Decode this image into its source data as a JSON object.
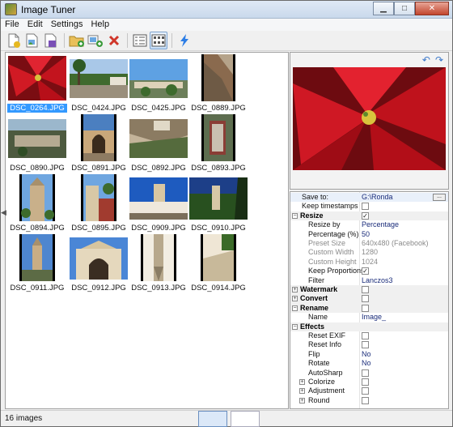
{
  "window": {
    "title": "Image Tuner"
  },
  "menu": [
    "File",
    "Edit",
    "Settings",
    "Help"
  ],
  "toolbar_icons": [
    "add-file-icon",
    "open-image-icon",
    "save-icon",
    "add-folder-icon",
    "add-images-icon",
    "remove-icon",
    "list-view-icon",
    "thumbnail-view-icon",
    "process-lightning-icon"
  ],
  "thumbnails": [
    {
      "name": "DSC_0264.JPG",
      "selected": true
    },
    {
      "name": "DSC_0424.JPG"
    },
    {
      "name": "DSC_0425.JPG"
    },
    {
      "name": "DSC_0889.JPG"
    },
    {
      "name": "DSC_0890.JPG"
    },
    {
      "name": "DSC_0891.JPG"
    },
    {
      "name": "DSC_0892.JPG"
    },
    {
      "name": "DSC_0893.JPG"
    },
    {
      "name": "DSC_0894.JPG"
    },
    {
      "name": "DSC_0895.JPG"
    },
    {
      "name": "DSC_0909.JPG"
    },
    {
      "name": "DSC_0910.JPG"
    },
    {
      "name": "DSC_0911.JPG"
    },
    {
      "name": "DSC_0912.JPG"
    },
    {
      "name": "DSC_0913.JPG"
    },
    {
      "name": "DSC_0914.JPG"
    }
  ],
  "properties": [
    {
      "name": "Save to:",
      "value": "G:\\Ronda",
      "kind": "text",
      "browse": "..."
    },
    {
      "name": "Keep timestamps",
      "kind": "check",
      "checked": false
    },
    {
      "name": "Resize",
      "kind": "cat",
      "expander": "−",
      "checked": true
    },
    {
      "name": "Resize by",
      "value": "Percentage",
      "kind": "sub"
    },
    {
      "name": "Percentage (%)",
      "value": "50",
      "kind": "sub"
    },
    {
      "name": "Preset Size",
      "value": "640x480 (Facebook)",
      "kind": "sub",
      "disabled": true
    },
    {
      "name": "Custom Width",
      "value": "1280",
      "kind": "sub",
      "disabled": true
    },
    {
      "name": "Custom Height",
      "value": "1024",
      "kind": "sub",
      "disabled": true
    },
    {
      "name": "Keep Proportions",
      "kind": "subcheck",
      "checked": true
    },
    {
      "name": "Filter",
      "value": "Lanczos3",
      "kind": "sub"
    },
    {
      "name": "Watermark",
      "kind": "cat",
      "expander": "+",
      "checked": false
    },
    {
      "name": "Convert",
      "kind": "cat",
      "expander": "+",
      "checked": false
    },
    {
      "name": "Rename",
      "kind": "cat",
      "expander": "−",
      "checked": false
    },
    {
      "name": "Name",
      "value": "Image_",
      "kind": "sub"
    },
    {
      "name": "Effects",
      "kind": "cat",
      "expander": "−"
    },
    {
      "name": "Reset EXIF",
      "kind": "subcheck",
      "checked": false
    },
    {
      "name": "Reset Info",
      "kind": "subcheck",
      "checked": false
    },
    {
      "name": "Flip",
      "value": "No",
      "kind": "sub"
    },
    {
      "name": "Rotate",
      "value": "No",
      "kind": "sub"
    },
    {
      "name": "AutoSharp",
      "kind": "subcheck",
      "checked": false
    },
    {
      "name": "Colorize",
      "kind": "subexp",
      "checked": false
    },
    {
      "name": "Adjustment",
      "kind": "subexp",
      "checked": false
    },
    {
      "name": "Round",
      "kind": "subexp",
      "checked": false
    }
  ],
  "status": {
    "count_text": "16 images"
  },
  "colors": {
    "selection": "#3399ff",
    "accent": "#3a77c9"
  }
}
